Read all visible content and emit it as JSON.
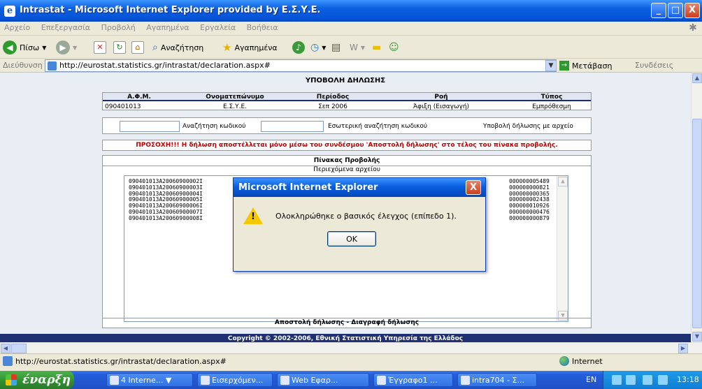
{
  "window": {
    "title": "Intrastat - Microsoft Internet Explorer provided by Ε.Σ.Υ.Ε.",
    "minimize_label": "_",
    "maximize_label": "□",
    "close_label": "X"
  },
  "menu": [
    "Αρχείο",
    "Επεξεργασία",
    "Προβολή",
    "Αγαπημένα",
    "Εργαλεία",
    "Βοήθεια"
  ],
  "toolbar": {
    "back_label": "Πίσω",
    "search_label": "Αναζήτηση",
    "favorites_label": "Αγαπημένα"
  },
  "address": {
    "label": "Διεύθυνση",
    "url": "http://eurostat.statistics.gr/intrastat/declaration.aspx#",
    "go_label": "Μετάβαση",
    "links_label": "Συνδέσεις"
  },
  "page": {
    "heading": "ΥΠΟΒΟΛΗ ΔΗΛΩΣΗΣ",
    "info_headers": [
      "Α.Φ.Μ.",
      "Ονοματεπώνυμο",
      "Περίοδος",
      "Ροή",
      "Τύπος"
    ],
    "info_values": [
      "090401013",
      "Ε.Σ.Υ.Ε.",
      "Σεπ 2006",
      "Άφιξη (Εισαγωγή)",
      "Εμπρόθεσμη"
    ],
    "search_code_label": "Αναζήτηση κωδικού",
    "internal_search_label": "Εσωτερική αναζήτηση κωδικού",
    "upload_file_label": "Υποβολή δήλωσης με αρχείο",
    "warning": "ΠΡΟΣΟΧΗ!!! Η δήλωση αποστέλλεται μόνο μέσω του συνδέσμου 'Αποστολή δήλωσης' στο τέλος του πίνακα προβολής.",
    "panel_title": "Πίνακας Προβολής",
    "panel_subtitle": "Περιεχόμενα αρχείου",
    "file_lines_left": [
      "090401013A20060900002I",
      "090401013A20060900003I",
      "090401013A20060900004I",
      "090401013A20060900005I",
      "090401013A20060900006I",
      "090401013A20060900007I",
      "090401013A20060900008I"
    ],
    "file_lines_right": [
      "000000005489",
      "000000000821",
      "000000000365",
      "000000002438",
      "000000010926",
      "000000000476",
      "000000000879"
    ],
    "actions": "Αποστολή δήλωσης - Διαγραφή δήλωσης",
    "copyright": "Copyright © 2002-2006, Εθνική Στατιστική Υπηρεσία της Ελλάδος"
  },
  "dialog": {
    "title": "Microsoft Internet Explorer",
    "message": "Ολοκληρώθηκε ο βασικός έλεγχος (επίπεδο 1).",
    "ok_label": "OK",
    "close_label": "X"
  },
  "status": {
    "url": "http://eurostat.statistics.gr/intrastat/declaration.aspx#",
    "zone": "Internet"
  },
  "taskbar": {
    "start_label": "έναρξη",
    "tasks": [
      "4 Interne...",
      "Εισερχόμεν...",
      "Web Εφαρ...",
      "Έγγραφο1 ...",
      "intra704 - Σ..."
    ],
    "language": "EN",
    "clock": "13:18"
  }
}
